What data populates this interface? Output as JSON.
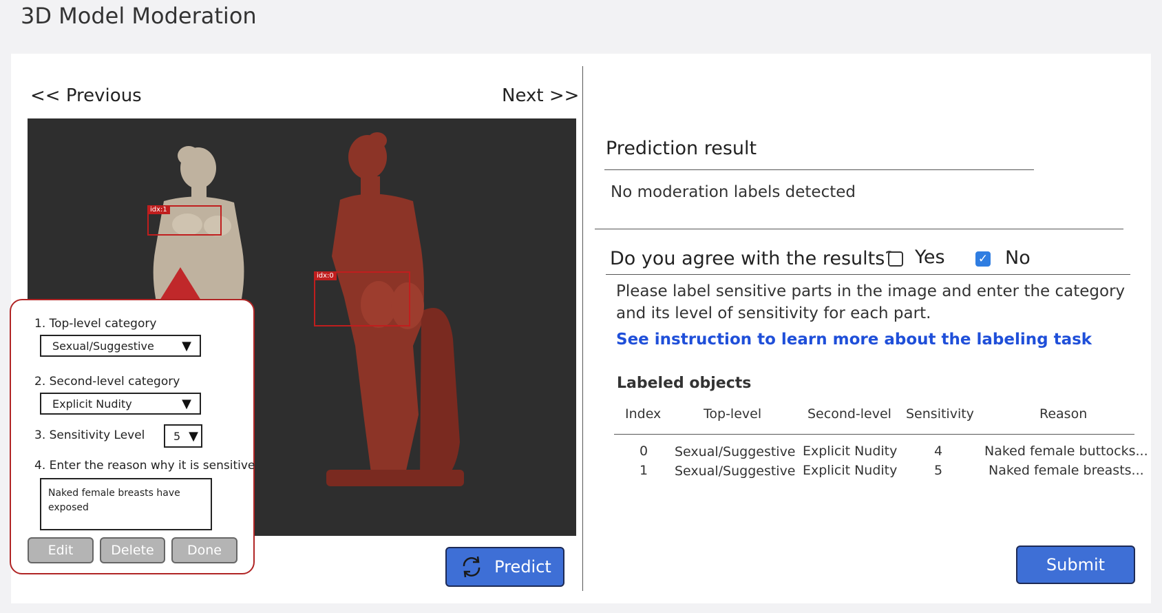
{
  "page": {
    "title": "3D Model Moderation"
  },
  "nav": {
    "previous_label": "<< Previous",
    "next_label": "Next >>"
  },
  "viewer": {
    "boxes": [
      {
        "tag": "idx:1"
      },
      {
        "tag": "idx:0"
      }
    ]
  },
  "popup": {
    "q1_label": "1. Top-level category",
    "q1_value": "Sexual/Suggestive",
    "q2_label": "2. Second-level category",
    "q2_value": "Explicit Nudity",
    "q3_label": "3. Sensitivity Level",
    "q3_value": "5",
    "q4_label": "4. Enter the reason why it is sensitive",
    "reason_text": "Naked female breasts have exposed",
    "edit_label": "Edit",
    "delete_label": "Delete",
    "done_label": "Done"
  },
  "predict": {
    "label": "Predict",
    "icon": "refresh-icon"
  },
  "prediction": {
    "title": "Prediction result",
    "result_text": "No moderation labels detected"
  },
  "agree": {
    "question": "Do you agree with the results?",
    "yes_label": "Yes",
    "yes_checked": false,
    "no_label": "No",
    "no_checked": true
  },
  "instructions": {
    "line1": "Please label sensitive parts in the image and enter the category",
    "line2": "and its level of sensitivity for each part.",
    "link_text": "See instruction to learn more about the labeling task"
  },
  "labeled": {
    "title": "Labeled objects",
    "headers": [
      "Index",
      "Top-level",
      "Second-level",
      "Sensitivity",
      "Reason"
    ],
    "rows": [
      [
        "0",
        "Sexual/Suggestive",
        "Explicit Nudity",
        "4",
        "Naked female buttocks..."
      ],
      [
        "1",
        "Sexual/Suggestive",
        "Explicit Nudity",
        "5",
        "Naked female breasts..."
      ]
    ]
  },
  "submit": {
    "label": "Submit"
  },
  "colors": {
    "accent": "#3e6fd6",
    "box": "#c01e1e",
    "link": "#1f4fd9"
  }
}
